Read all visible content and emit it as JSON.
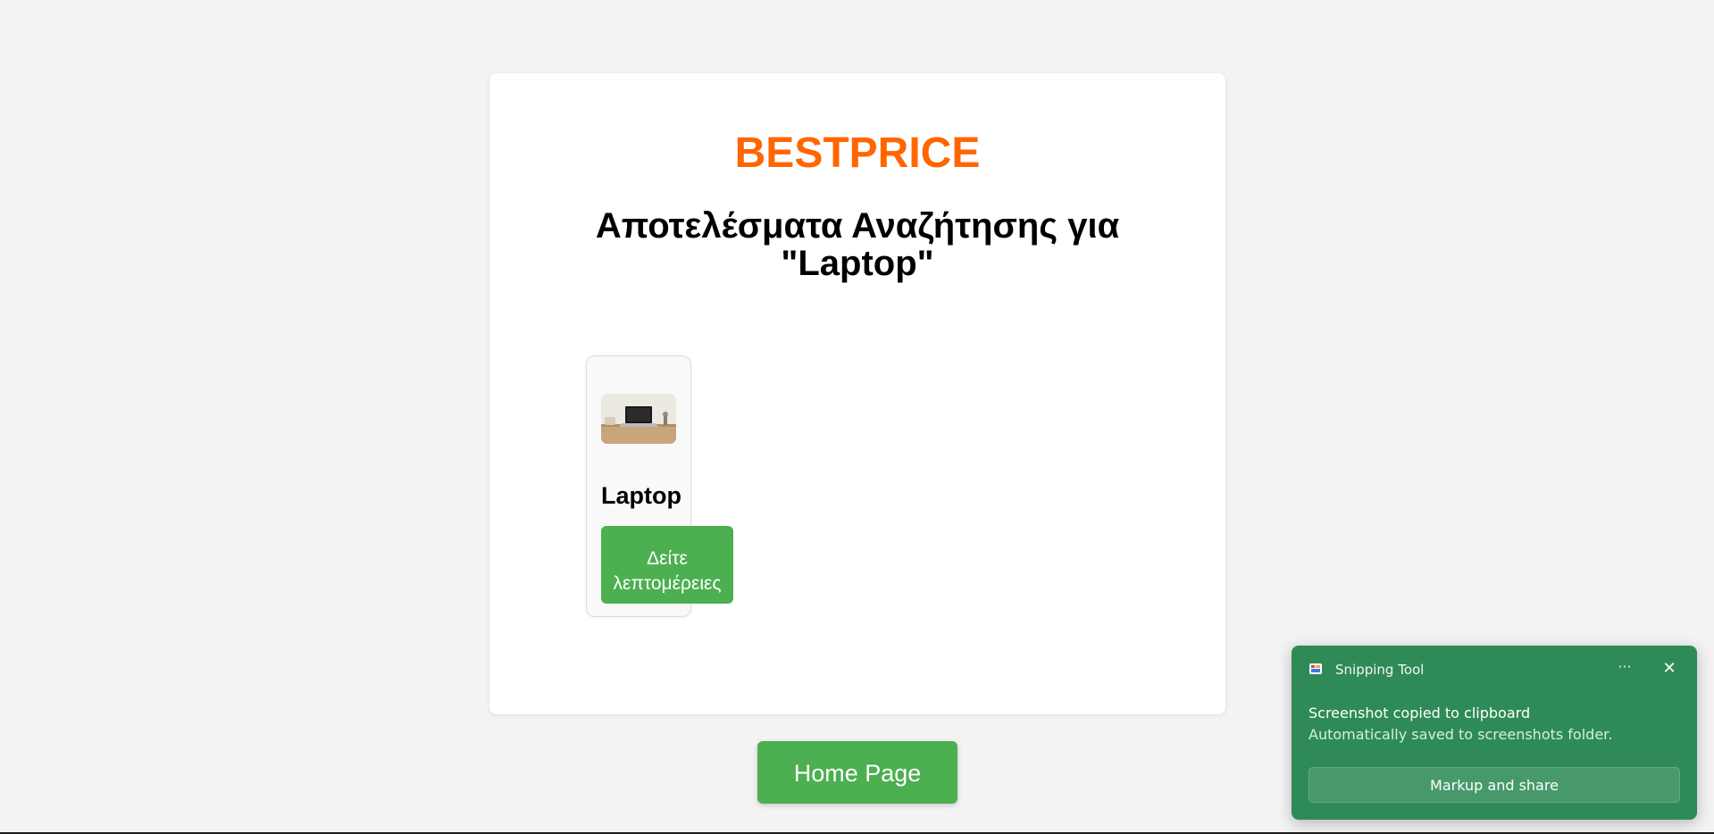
{
  "page": {
    "brand": "BESTPRICE",
    "results_title": "Αποτελέσματα Αναζήτησης για \"Laptop\"",
    "home_button_label": "Home Page"
  },
  "products": [
    {
      "name": "Laptop",
      "image_icon": "laptop-photo",
      "details_label_line1": "Δείτε",
      "details_label_line2": "λεπτομέρειες"
    }
  ],
  "toast": {
    "app_name": "Snipping Tool",
    "app_icon": "snipping-tool-icon",
    "more_glyph": "···",
    "close_glyph": "✕",
    "heading": "Screenshot copied to clipboard",
    "body": "Automatically saved to screenshots folder.",
    "action_label": "Markup and share"
  },
  "colors": {
    "brand": "#ff6600",
    "button_green": "#4caf50",
    "toast_green": "#2e8b57",
    "page_background": "#f3f3f3"
  }
}
